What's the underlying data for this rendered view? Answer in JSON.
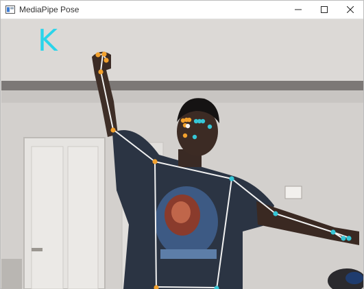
{
  "window": {
    "title": "MediaPipe Pose",
    "app_icon": "app-window-icon",
    "controls": {
      "minimize_icon": "minimize-icon",
      "maximize_icon": "maximize-icon",
      "close_icon": "close-icon"
    }
  },
  "overlay": {
    "label": "K",
    "label_color": "#2ad4ea",
    "left_landmark_color": "#f2a12e",
    "right_landmark_color": "#36c6d6",
    "connection_color": "#f2f2f2"
  }
}
